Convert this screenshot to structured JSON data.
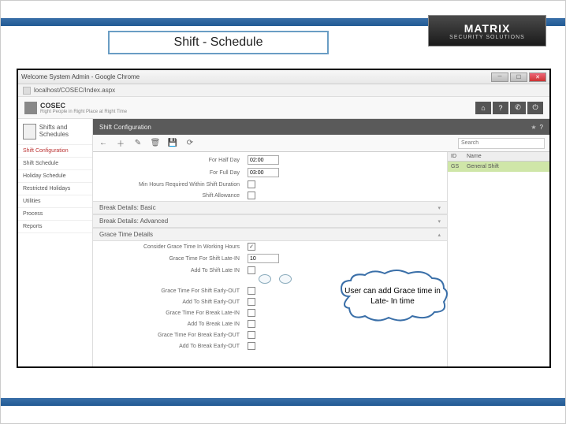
{
  "slide": {
    "title": "Shift - Schedule",
    "logo_main": "MATRIX",
    "logo_sub": "SECURITY SOLUTIONS"
  },
  "chrome": {
    "title": "Welcome System Admin - Google Chrome",
    "url": "localhost/COSEC/Index.aspx"
  },
  "app": {
    "name": "COSEC",
    "tagline": "Right People in Right Place at Right Time"
  },
  "sidebar": {
    "title": "Shifts and Schedules",
    "items": [
      {
        "label": "Shift Configuration",
        "active": true
      },
      {
        "label": "Shift Schedule"
      },
      {
        "label": "Holiday Schedule"
      },
      {
        "label": "Restricted Holidays"
      },
      {
        "label": "Utilities"
      },
      {
        "label": "Process"
      },
      {
        "label": "Reports"
      }
    ]
  },
  "main": {
    "page_title": "Shift Configuration",
    "search_placeholder": "Search"
  },
  "list": {
    "col_id": "ID",
    "col_name": "Name",
    "rows": [
      {
        "id": "GS",
        "name": "General Shift"
      }
    ]
  },
  "form": {
    "for_half_day_label": "For Half Day",
    "for_half_day_value": "02:00",
    "for_full_day_label": "For Full Day",
    "for_full_day_value": "03:00",
    "min_hours_label": "Min Hours Required Within Shift Duration",
    "min_hours_checked": false,
    "shift_allowance_label": "Shift Allowance",
    "shift_allowance_checked": false,
    "section_break_basic": "Break Details: Basic",
    "section_break_adv": "Break Details: Advanced",
    "section_grace": "Grace Time Details",
    "consider_grace_label": "Consider Grace Time In Working Hours",
    "consider_grace_checked": true,
    "late_in_label": "Grace Time For Shift Late-IN",
    "late_in_value": "10",
    "add_late_in_label": "Add To Shift Late IN",
    "add_late_in_checked": false,
    "early_out_label": "Grace Time For Shift Early-OUT",
    "early_out_checked": false,
    "add_early_out_label": "Add To Shift Early-OUT",
    "add_early_out_checked": false,
    "break_late_in_label": "Grace Time For Break Late-IN",
    "break_late_in_checked": false,
    "add_break_late_in_label": "Add To Break Late IN",
    "add_break_late_in_checked": false,
    "break_early_out_label": "Grace Time For Break Early-OUT",
    "break_early_out_checked": false,
    "add_break_early_out_label": "Add To Break Early-OUT",
    "add_break_early_out_checked": false
  },
  "callout": {
    "text": "User can add Grace time in Late- In time"
  }
}
